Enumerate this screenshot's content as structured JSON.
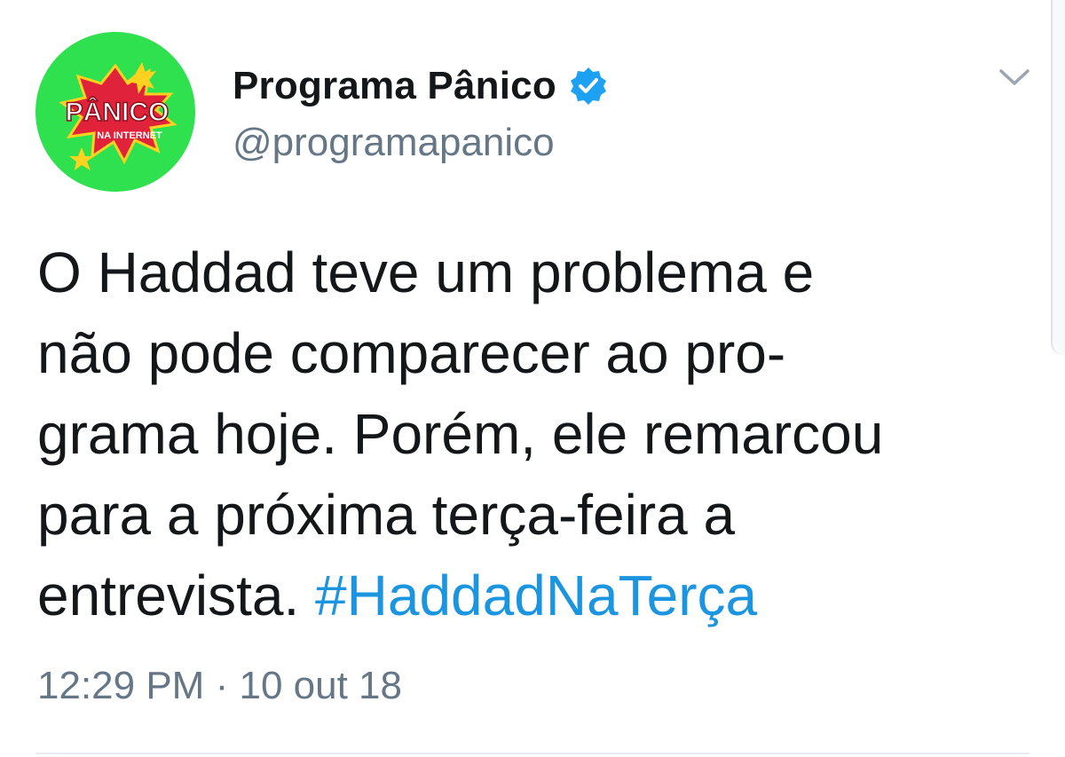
{
  "tweet": {
    "display_name": "Programa Pânico",
    "handle": "@programapanico",
    "verified": true,
    "avatar": {
      "logo_text": "PÂNICO",
      "logo_subtext": "NA INTERNET",
      "bg_color": "#2fe04f"
    },
    "text_lines": [
      "O Haddad teve um problema e",
      "não pode comparecer ao pro-",
      "grama hoje. Porém, ele remarcou",
      "para a próxima terça-feira a"
    ],
    "text_last_line_prefix": "entrevista. ",
    "hashtag": "#HaddadNaTerça",
    "time": "12:29 PM",
    "separator": "·",
    "date": "10 out 18"
  },
  "icons": {
    "verified": "verified-badge-icon",
    "menu": "chevron-down-icon"
  },
  "colors": {
    "text": "#14171a",
    "secondary": "#657786",
    "link": "#1b95e0",
    "verified": "#1da1f2"
  }
}
